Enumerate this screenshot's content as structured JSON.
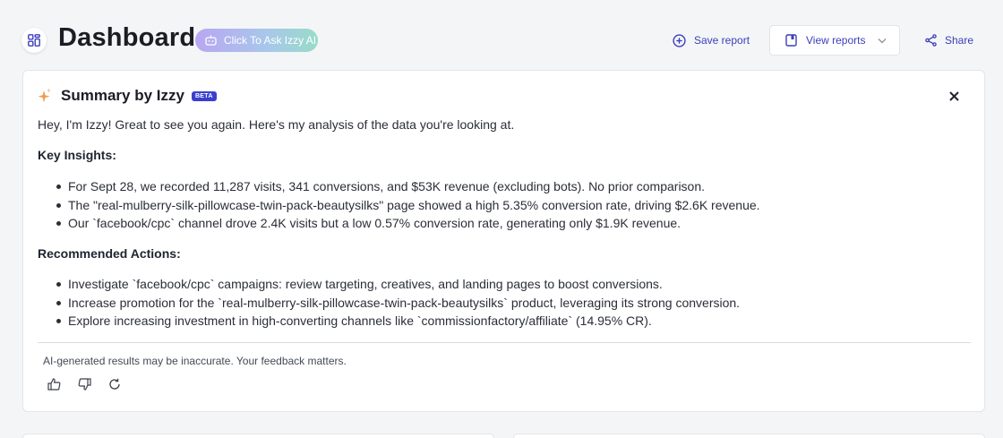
{
  "header": {
    "title": "Dashboard",
    "ask_button": "Click To Ask Izzy AI",
    "save_report": "Save report",
    "view_reports": "View reports",
    "share": "Share"
  },
  "summary": {
    "title": "Summary by Izzy",
    "badge": "BETA",
    "intro": "Hey, I'm Izzy! Great to see you again. Here's my analysis of the data you're looking at.",
    "insights_heading": "Key Insights:",
    "insights": [
      "For Sept 28, we recorded 11,287 visits, 341 conversions, and $53K revenue (excluding bots). No prior comparison.",
      "The \"real-mulberry-silk-pillowcase-twin-pack-beautysilks\" page showed a high 5.35% conversion rate, driving $2.6K revenue.",
      "Our `facebook/cpc` channel drove 2.4K visits but a low 0.57% conversion rate, generating only $1.9K revenue."
    ],
    "actions_heading": "Recommended Actions:",
    "actions": [
      "Investigate `facebook/cpc` campaigns: review targeting, creatives, and landing pages to boost conversions.",
      "Increase promotion for the `real-mulberry-silk-pillowcase-twin-pack-beautysilks` product, leveraging its strong conversion.",
      "Explore increasing investment in high-converting channels like `commissionfactory/affiliate` (14.95% CR)."
    ],
    "disclaimer": "AI-generated results may be inaccurate. Your feedback matters."
  },
  "icons": {
    "grid": "dashboard-grid-icon",
    "robot": "robot-icon",
    "save": "plus-circle-icon",
    "reports": "book-icon",
    "chevron": "chevron-down-icon",
    "share": "share-icon",
    "sparkle": "sparkle-icon",
    "close": "close-icon",
    "thumbs_up": "thumbs-up-icon",
    "thumbs_down": "thumbs-down-icon",
    "refresh": "refresh-icon"
  },
  "colors": {
    "accent": "#3b3fb8",
    "badge": "#3b3fcf",
    "sparkle": "#f39a4c",
    "background": "#f4f5f7"
  }
}
